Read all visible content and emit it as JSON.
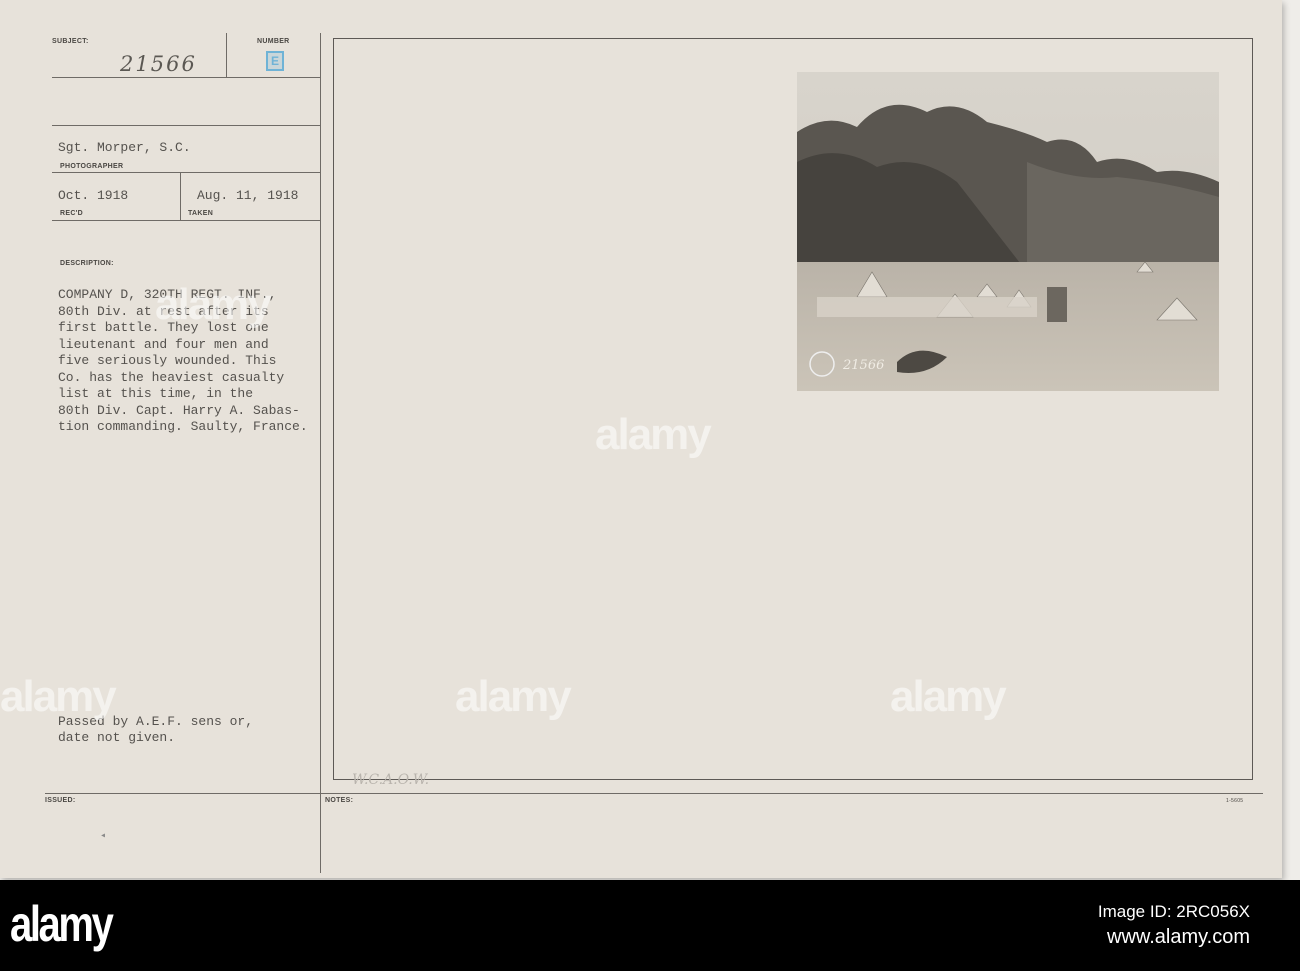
{
  "card": {
    "subject_label": "SUBJECT:",
    "subject_number": "21566",
    "number_label": "NUMBER",
    "number_stamp": "E",
    "photographer": "Sgt. Morper, S.C.",
    "photographer_label": "PHOTOGRAPHER",
    "received": "Oct. 1918",
    "received_label": "REC'D",
    "taken": "Aug. 11, 1918",
    "taken_label": "TAKEN",
    "description_label": "DESCRIPTION:",
    "description_lines": [
      "COMPANY D, 320TH REGT. INF.,",
      "80th Div. at rest after its",
      "first battle. They lost one",
      "lieutenant and four men and",
      "five seriously wounded. This",
      "Co. has the heaviest casualty",
      "list at this time, in the",
      "80th Div. Capt. Harry A. Sabas-",
      "tion commanding. Saulty, France."
    ],
    "censor_lines": [
      "Passed by A.E.F. sens or,",
      "date not given."
    ],
    "issued_label": "ISSUED:",
    "notes_label": "NOTES:",
    "notes_handwriting": "W.C.A.O.W.",
    "form_number": "1-5605",
    "photo_number": "21566"
  },
  "watermark": "alamy",
  "footer": {
    "logo": "alamy",
    "image_id": "Image ID: 2RC056X",
    "url": "www.alamy.com"
  }
}
